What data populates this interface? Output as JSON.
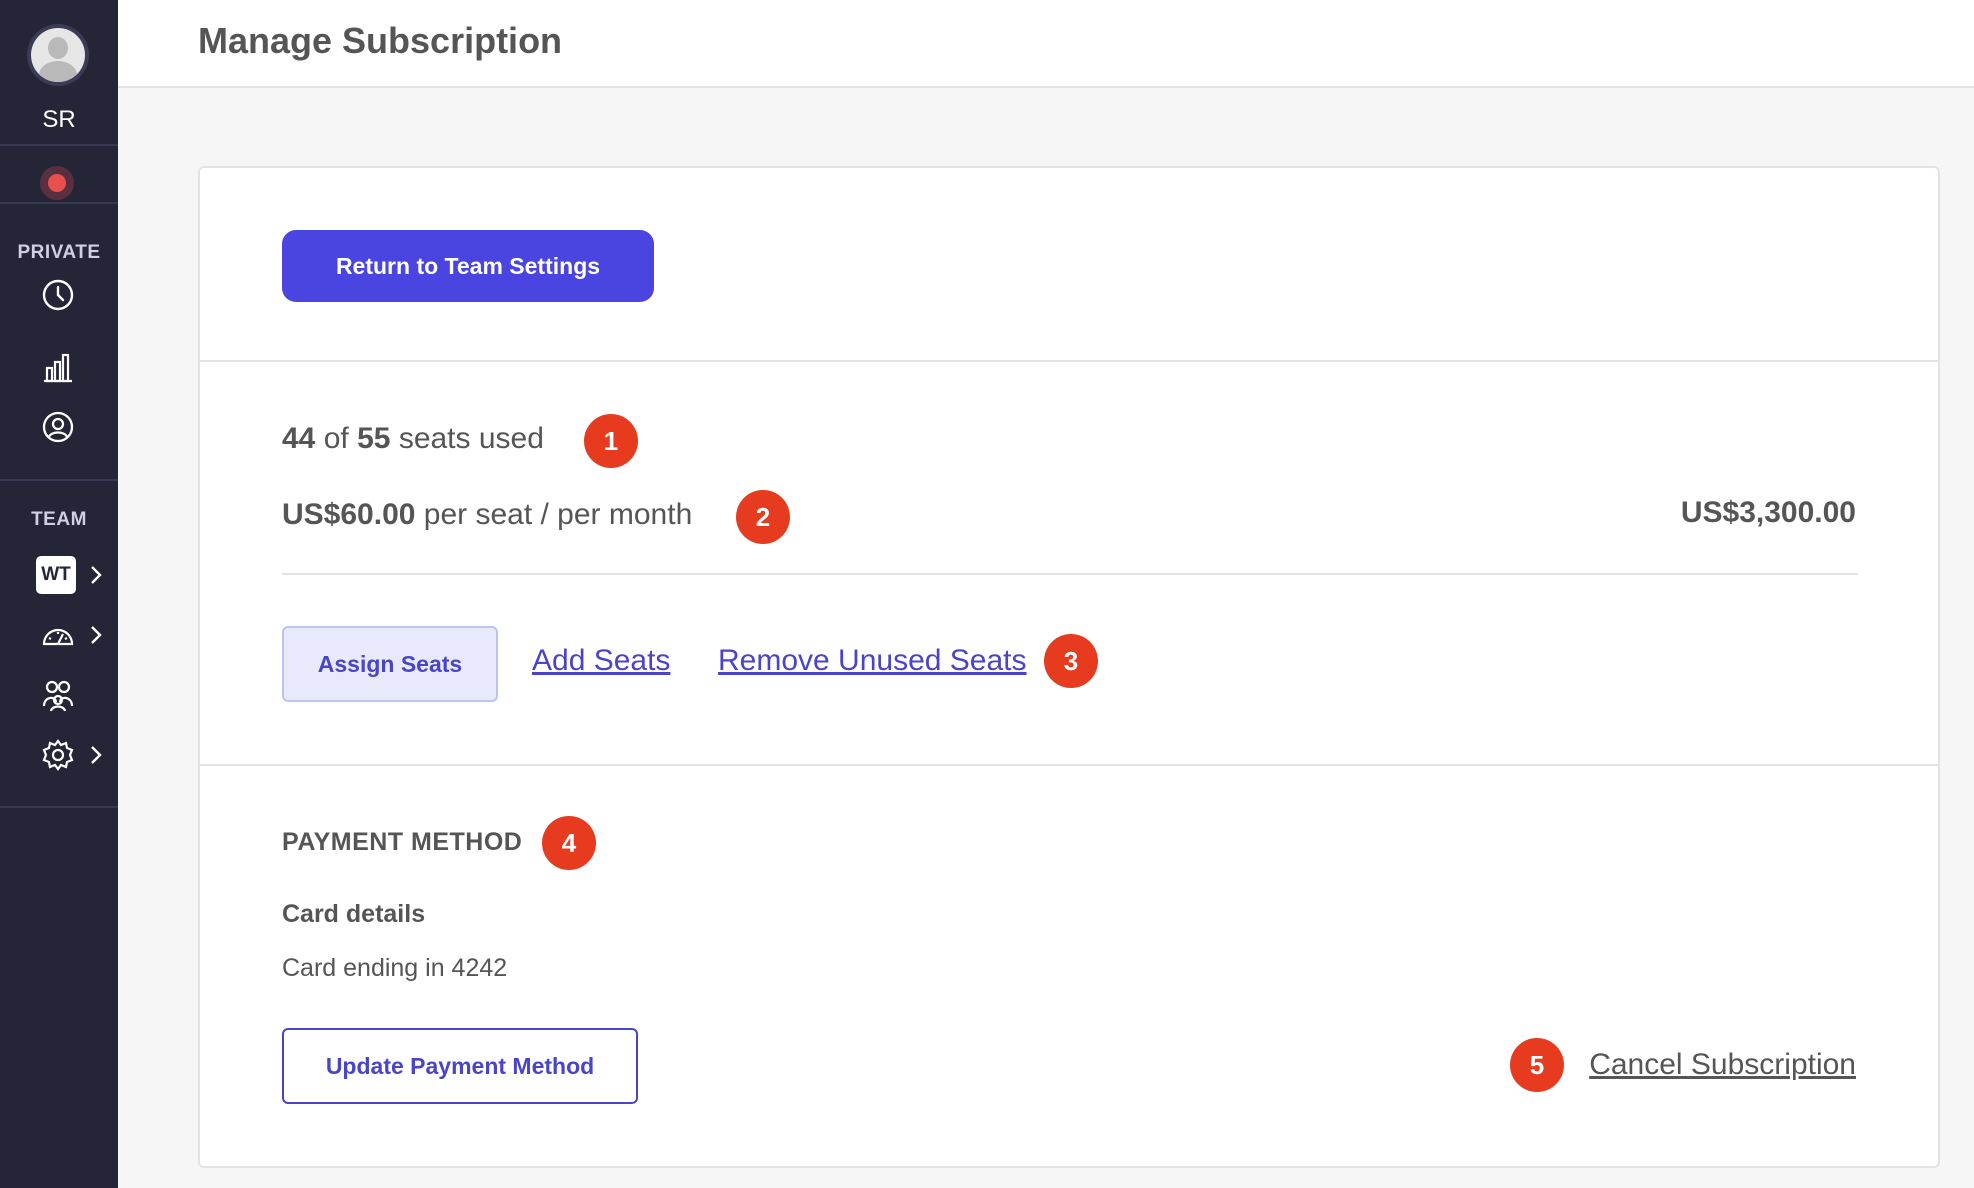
{
  "sidebar": {
    "initials": "SR",
    "sections": {
      "private": "PRIVATE",
      "team": "TEAM"
    },
    "team_badge": "WT",
    "icons": [
      "clock-icon",
      "bar-chart-icon",
      "user-circle-icon",
      "dashboard-gauge-icon",
      "people-icon",
      "gear-icon"
    ]
  },
  "header": {
    "title": "Manage Subscription"
  },
  "card": {
    "return_button": "Return to Team Settings",
    "seats": {
      "used": "44",
      "of_label": "of",
      "total": "55",
      "suffix": "seats used"
    },
    "pricing": {
      "price": "US$60.00",
      "period": "per seat / per month",
      "total": "US$3,300.00"
    },
    "actions": {
      "assign": "Assign Seats",
      "add": "Add Seats",
      "remove": "Remove Unused Seats"
    },
    "payment": {
      "title": "PAYMENT METHOD",
      "card_details_label": "Card details",
      "card_ending": "Card ending in 4242",
      "update_button": "Update Payment Method",
      "cancel_link": "Cancel Subscription"
    },
    "badges": [
      "1",
      "2",
      "3",
      "4",
      "5"
    ]
  },
  "colors": {
    "primary": "#4a44e0",
    "badge": "#e63b1f",
    "sidebar": "#252538",
    "link": "#4a44c8"
  }
}
